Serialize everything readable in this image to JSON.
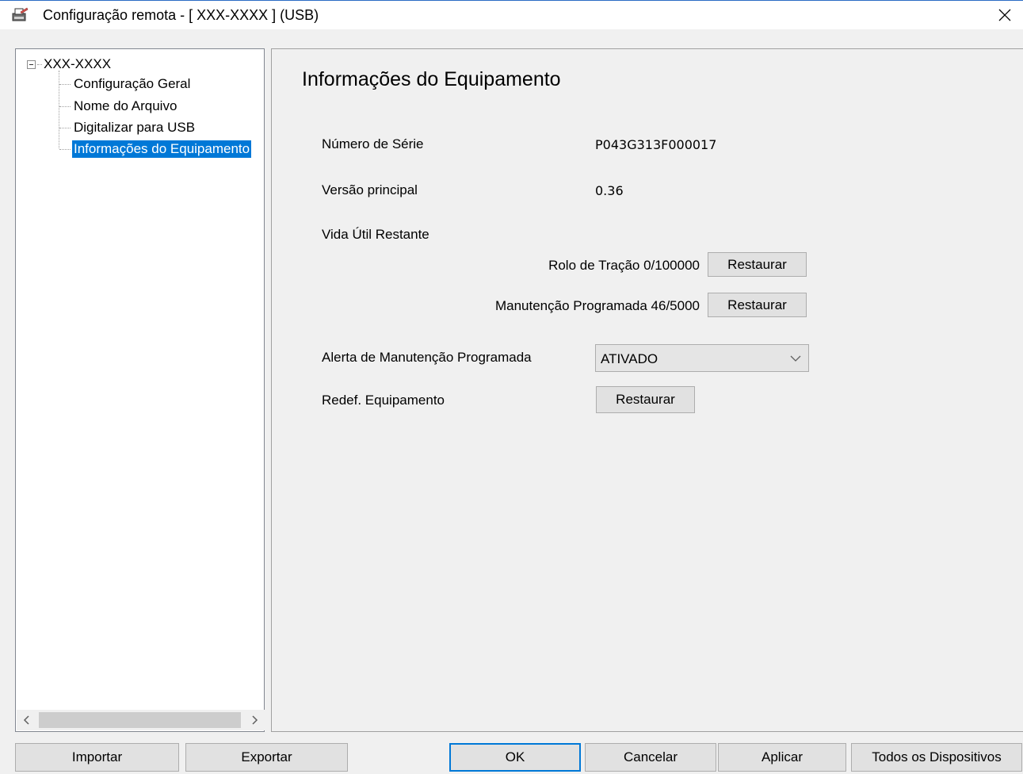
{
  "window": {
    "title": "Configuração remota - [ XXX-XXXX ] (USB)"
  },
  "icons": {
    "app": "printer-settings-icon",
    "close": "close-icon",
    "scroll_left": "chevron-left-icon",
    "scroll_right": "chevron-right-icon",
    "dropdown": "chevron-down-icon"
  },
  "colors": {
    "selection": "#0078d7",
    "accent": "#0078d7"
  },
  "tree": {
    "root": "XXX-XXXX",
    "items": [
      {
        "label": "Configuração Geral",
        "selected": false
      },
      {
        "label": "Nome do Arquivo",
        "selected": false
      },
      {
        "label": "Digitalizar para USB",
        "selected": false
      },
      {
        "label": "Informações do Equipamento",
        "selected": true
      }
    ]
  },
  "content": {
    "title": "Informações do Equipamento",
    "serial_label": "Número de Série",
    "serial_value": "P043G313F000017",
    "version_label": "Versão principal",
    "version_value": "0.36",
    "life_label": "Vida Útil Restante",
    "roller_label": "Rolo de Tração 0/100000",
    "roller_button": "Restaurar",
    "maintenance_label": "Manutenção Programada 46/5000",
    "maintenance_button": "Restaurar",
    "alert_label": "Alerta de Manutenção Programada",
    "alert_value": "ATIVADO",
    "reset_label": "Redef. Equipamento",
    "reset_button": "Restaurar"
  },
  "footer": {
    "import": "Importar",
    "export": "Exportar",
    "ok": "OK",
    "cancel": "Cancelar",
    "apply": "Aplicar",
    "all_devices": "Todos os Dispositivos"
  }
}
